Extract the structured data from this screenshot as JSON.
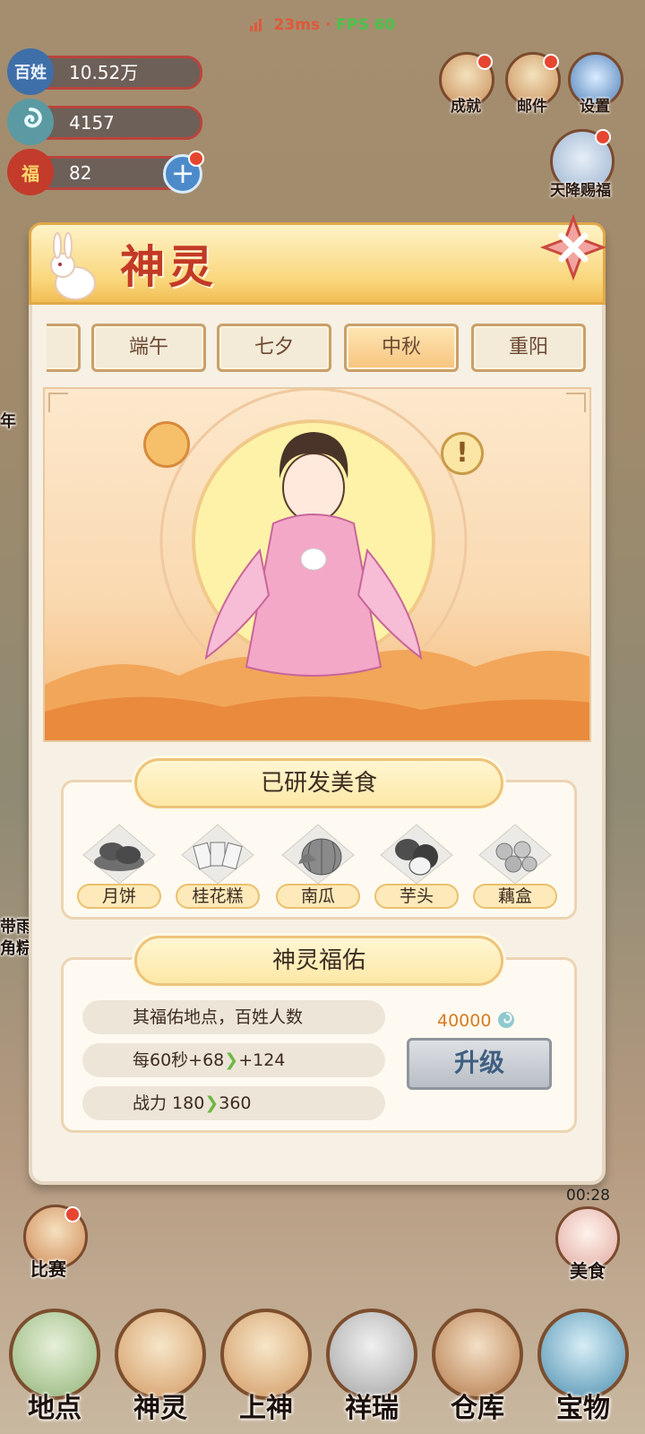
{
  "status": {
    "ping": "23ms",
    "separator": "·",
    "fps": "FPS 60"
  },
  "resources": {
    "population": {
      "icon_text": "百姓",
      "value": "10.52万"
    },
    "spirit": {
      "value": "4157"
    },
    "bag": {
      "icon_text": "福",
      "value": "82"
    }
  },
  "top_right": {
    "achievement": "成就",
    "mail": "邮件",
    "settings": "设置",
    "blessing": "天降赐福"
  },
  "panel": {
    "title": "神灵",
    "tabs": [
      "",
      "端午",
      "七夕",
      "中秋",
      "重阳"
    ],
    "active_tab": "中秋",
    "researched_title": "已研发美食",
    "foods": [
      "月饼",
      "桂花糕",
      "南瓜",
      "芋头",
      "藕盒"
    ],
    "blessing_title": "神灵福佑",
    "stats": [
      "其福佑地点，百姓人数"
    ],
    "per_60s": {
      "prefix": "每60秒+68",
      "next": "+124"
    },
    "power": {
      "prefix": "战力 180",
      "next": "360"
    },
    "upgrade_cost": "40000",
    "upgrade_label": "升级"
  },
  "side": {
    "left_partial_1": "年",
    "left_partial_2": "带雨",
    "left_partial_3": "角粽",
    "match": "比赛",
    "food": "美食",
    "timer": "00:28"
  },
  "bottom_nav": [
    "地点",
    "神灵",
    "上神",
    "祥瑞",
    "仓库",
    "宝物"
  ],
  "colors": {
    "title_red": "#c23a26",
    "accent_gold": "#f2be55",
    "ping_red": "#e0583a",
    "fps_green": "#49c24a",
    "arrow_green": "#6cb845",
    "cost_orange": "#d67b1f"
  }
}
